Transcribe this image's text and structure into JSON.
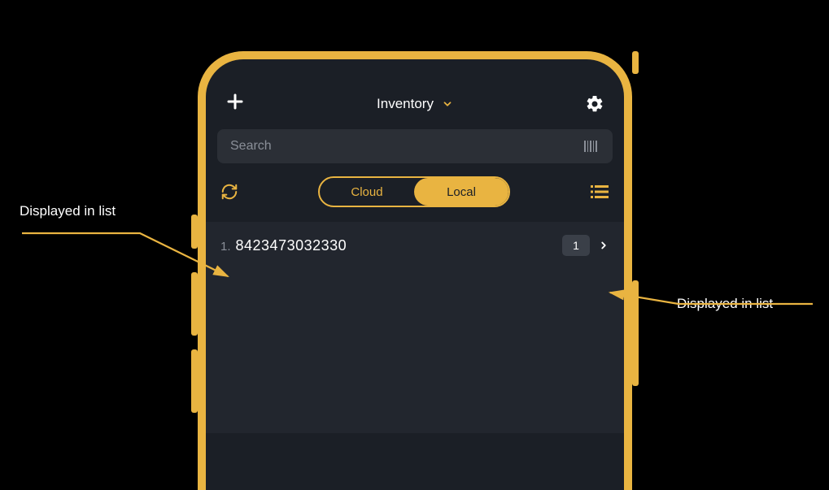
{
  "header": {
    "title": "Inventory"
  },
  "search": {
    "placeholder": "Search"
  },
  "segment": {
    "cloud_label": "Cloud",
    "local_label": "Local"
  },
  "list": {
    "items": [
      {
        "index": "1.",
        "code": "8423473032330",
        "qty": "1"
      }
    ]
  },
  "annotations": {
    "left": "Displayed in list",
    "right": "Displayed in list"
  }
}
